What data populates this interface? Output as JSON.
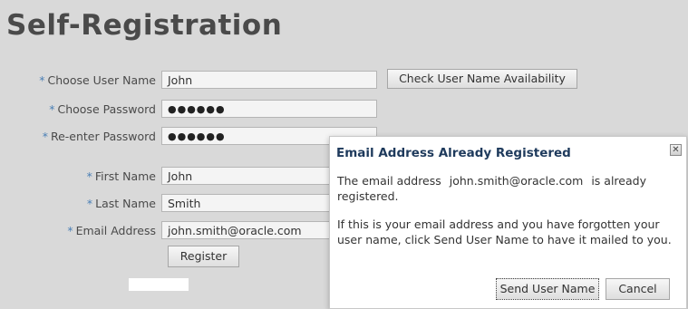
{
  "page": {
    "title": "Self-Registration"
  },
  "form": {
    "required_marker": "*",
    "username": {
      "label": "Choose User Name",
      "value": "John"
    },
    "password": {
      "label": "Choose Password",
      "value": "●●●●●●"
    },
    "reenter": {
      "label": "Re-enter Password",
      "value": "●●●●●●"
    },
    "first_name": {
      "label": "First Name",
      "value": "John"
    },
    "last_name": {
      "label": "Last Name",
      "value": "Smith"
    },
    "email": {
      "label": "Email Address",
      "value": "john.smith@oracle.com"
    },
    "check_button": "Check User Name Availability",
    "register_button": "Register"
  },
  "dialog": {
    "title": "Email Address Already Registered",
    "close_icon": "close-icon",
    "message_prefix": "The email address",
    "email": "john.smith@oracle.com",
    "message_suffix": "is already registered.",
    "message2": "If this is your email address and you have forgotten your user name, click Send User Name to have it mailed to you.",
    "send_button": "Send User Name",
    "cancel_button": "Cancel"
  }
}
